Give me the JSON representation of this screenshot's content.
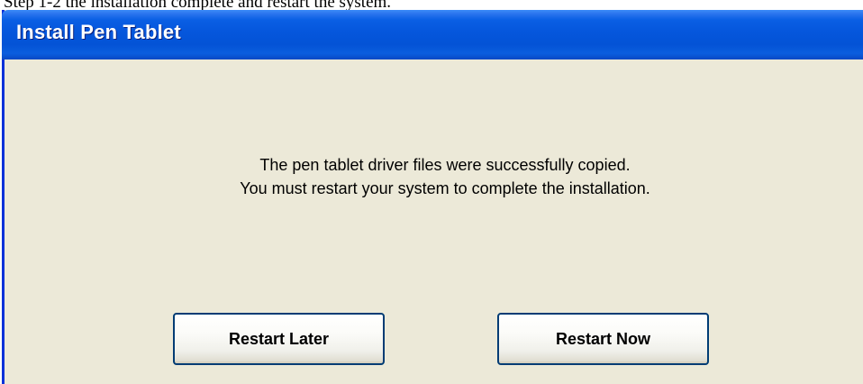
{
  "caption": "Step 1-2 the installation complete and restart the system.",
  "window": {
    "title": "Install Pen Tablet",
    "message_lines": [
      "The pen tablet driver files were successfully copied.",
      "You must restart your system to complete the installation."
    ]
  },
  "buttons": {
    "restart_later": "Restart Later",
    "restart_now": "Restart Now"
  },
  "colors": {
    "titlebar": "#0556dc",
    "dialog_background": "#ece9d8",
    "button_border": "#003c74"
  }
}
